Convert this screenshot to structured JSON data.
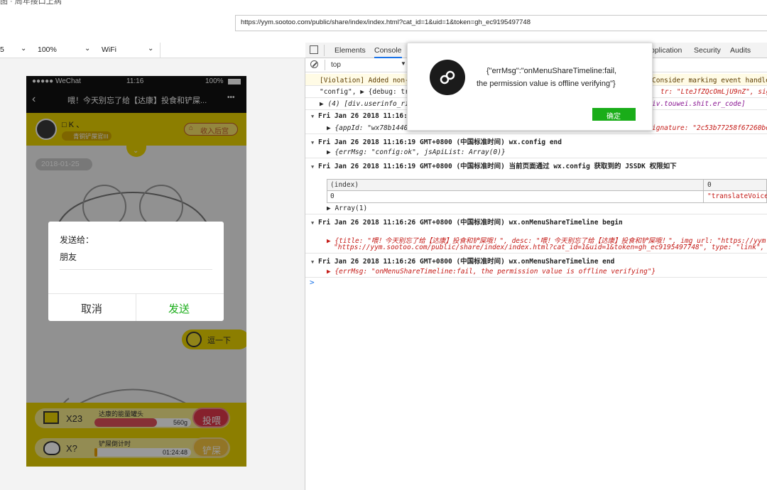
{
  "window": {
    "title": "图 · 周年接口上病"
  },
  "browser": {
    "url": "https://yym.sootoo.com/public/share/index/index.html?cat_id=1&uid=1&token=gh_ec9195497748"
  },
  "device_toolbar": {
    "size_value": "5",
    "zoom_value": "100%",
    "network_value": "WiFi"
  },
  "phone": {
    "status": {
      "carrier": "●●●●● WeChat",
      "time": "11:16",
      "battery": "100%"
    },
    "nav": {
      "title": "喂！今天别忘了给【达康】投食和铲屎...",
      "more": "•••"
    },
    "user": {
      "name": "□ K 、",
      "level": "青铜铲屎官III"
    },
    "collect_label": "收入后宫",
    "date_badge": "2018-01-25",
    "walk_label": "逗一下",
    "feed_row": {
      "count": "X23",
      "label": "达康的能量罐头",
      "value": "560g",
      "button": "投喂",
      "progress": 0.65
    },
    "poop_row": {
      "count": "X?",
      "label": "铲屎倒计时",
      "value": "01:24:48",
      "button": "铲屎",
      "progress": 0.03
    },
    "dialog": {
      "send_to": "发送给：",
      "recipient": "朋友",
      "cancel": "取消",
      "send": "发送"
    }
  },
  "devtools": {
    "tabs": [
      "Elements",
      "Console",
      "pplication",
      "Security",
      "Audits"
    ],
    "context": "top",
    "lines": {
      "violation": "[Violation] Added non-p",
      "violation_tail": "Consider marking event handler",
      "config_head": "\"config\", ▶ {debug: tru",
      "config_tail": "tr: \"LteJfZQcOmLjU9nZ\", signat",
      "div_head": "▶ (4) [div.userinfo_rig",
      "div_tail": "iv.touwei.shit.er_code]",
      "ts1": "Fri Jan 26 2018 11:16:1",
      "appid_head": "▶ {appId: \"wx78b14405",
      "appid_tail": "ignature: \"2c53b77258f67260be2",
      "ts2": "Fri Jan 26 2018 11:16:19 GMT+0800 (中国标准时间) wx.config end",
      "errmsg_ok": "▶ {errMsg: \"config:ok\", jsApiList: Array(0)}",
      "ts3": "Fri Jan 26 2018 11:16:19 GMT+0800 (中国标准时间) 当前页面通过 wx.config 获取到的 JSSDK 权限如下",
      "table_head_index": "(index)",
      "table_head_0": "0",
      "table_row_index": "0",
      "table_row_value": "\"translateVoice\"",
      "array": "▶ Array(1)",
      "ts4": "Fri Jan 26 2018 11:16:26 GMT+0800 (中国标准时间) wx.onMenuShareTimeline begin",
      "share_obj1": "▶ {title: \"喂！今天别忘了给【达康】投食和铲屎哦！\", desc: \"喂！今天别忘了给【达康】投食和铲屎哦！\", img_url: \"https://yym",
      "share_obj2": "\"https://yym.sootoo.com/public/share/index/index.html?cat_id=1&uid=1&token=gh_ec9195497748\", type: \"link\", …}",
      "ts5": "Fri Jan 26 2018 11:16:26 GMT+0800 (中国标准时间) wx.onMenuShareTimeline end",
      "errmsg_fail": "▶ {errMsg: \"onMenuShareTimeline:fail, the permission value is offline verifying\"}",
      "prompt": ">"
    },
    "popup": {
      "message_line1": "{\"errMsg\":\"onMenuShareTimeline:fail,",
      "message_line2": "the permission value is offline verifying\"}",
      "confirm": "确定"
    }
  },
  "colors": {
    "wechat_green": "#1aad19",
    "phone_yellow": "#e9d200",
    "console_string": "#c41a16",
    "dialog_send": "#1aad19"
  }
}
